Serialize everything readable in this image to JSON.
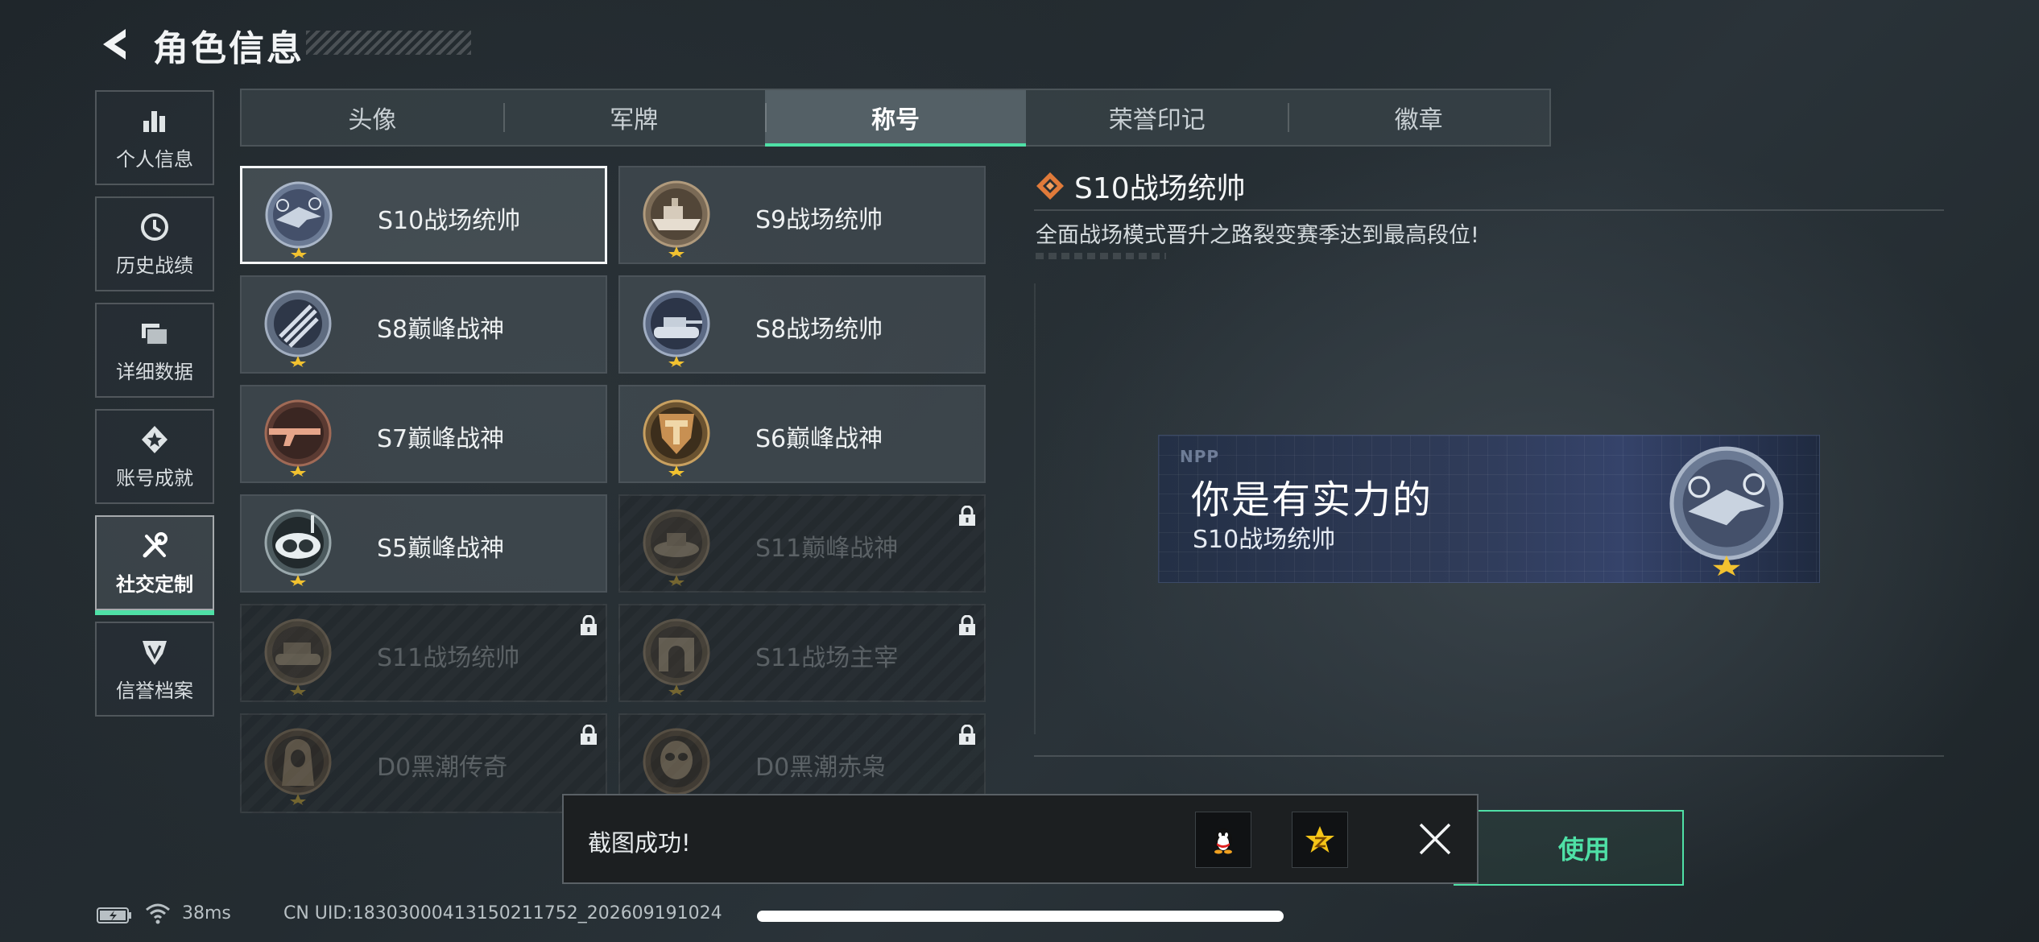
{
  "header": {
    "title": "角色信息",
    "back_icon": "chevron-left-icon"
  },
  "sidebar": {
    "items": [
      {
        "label": "个人信息",
        "icon": "bar-chart-icon",
        "active": false
      },
      {
        "label": "历史战绩",
        "icon": "clock-history-icon",
        "active": false
      },
      {
        "label": "详细数据",
        "icon": "folder-icon",
        "active": false
      },
      {
        "label": "账号成就",
        "icon": "achievement-star-icon",
        "active": false
      },
      {
        "label": "社交定制",
        "icon": "wrench-screwdriver-icon",
        "active": true
      },
      {
        "label": "信誉档案",
        "icon": "shield-rank-icon",
        "active": false
      }
    ]
  },
  "tabs": [
    {
      "label": "头像",
      "active": false
    },
    {
      "label": "军牌",
      "active": false
    },
    {
      "label": "称号",
      "active": true
    },
    {
      "label": "荣誉印记",
      "active": false
    },
    {
      "label": "徽章",
      "active": false
    }
  ],
  "titles": [
    {
      "name": "S10战场统帅",
      "medal": "aircraft-medal-icon",
      "locked": false,
      "selected": true
    },
    {
      "name": "S9战场统帅",
      "medal": "ship-medal-icon",
      "locked": false,
      "selected": false
    },
    {
      "name": "S8巅峰战神",
      "medal": "crossed-bars-medal-icon",
      "locked": false,
      "selected": false
    },
    {
      "name": "S8战场统帅",
      "medal": "tank-medal-icon",
      "locked": false,
      "selected": false
    },
    {
      "name": "S7巅峰战神",
      "medal": "rifle-medal-icon",
      "locked": false,
      "selected": false
    },
    {
      "name": "S6巅峰战神",
      "medal": "shield-t-medal-icon",
      "locked": false,
      "selected": false
    },
    {
      "name": "S5巅峰战神",
      "medal": "diving-mask-medal-icon",
      "locked": false,
      "selected": false
    },
    {
      "name": "S11巅峰战神",
      "medal": "hovercraft-medal-icon",
      "locked": true,
      "selected": false
    },
    {
      "name": "S11战场统帅",
      "medal": "armored-vehicle-medal-icon",
      "locked": true,
      "selected": false
    },
    {
      "name": "S11战场主宰",
      "medal": "arch-medal-icon",
      "locked": true,
      "selected": false
    },
    {
      "name": "D0黑潮传奇",
      "medal": "hooded-figure-medal-icon",
      "locked": true,
      "selected": false
    },
    {
      "name": "D0黑潮赤枭",
      "medal": "skull-mask-medal-icon",
      "locked": true,
      "selected": false
    }
  ],
  "detail": {
    "title": "S10战场统帅",
    "description": "全面战场模式晋升之路裂变赛季达到最高段位!",
    "icon": "diamond-rank-icon"
  },
  "banner": {
    "tag": "NPP",
    "main_text": "你是有实力的",
    "sub_text": "S10战场统帅",
    "medal": "aircraft-medal-icon"
  },
  "use_button": {
    "label": "使用"
  },
  "toast": {
    "message": "截图成功!",
    "share_targets": [
      "qq-penguin-icon",
      "qzone-star-icon"
    ],
    "close_icon": "close-x-icon"
  },
  "footer": {
    "ping": "38ms",
    "uid": "CN UID:18303000413150211752_202609191024"
  },
  "colors": {
    "accent": "#4fe0a6",
    "gold_star": "#f2c230",
    "detail_icon": "#e07a3a"
  }
}
